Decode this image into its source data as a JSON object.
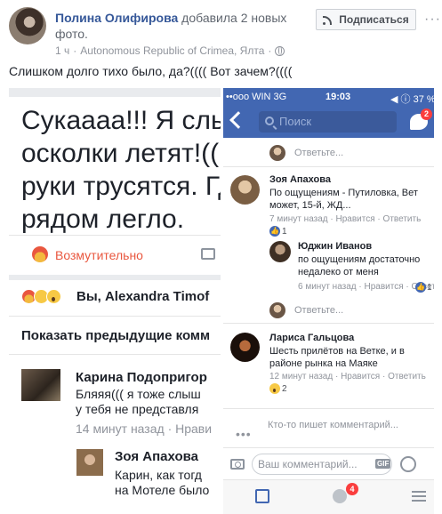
{
  "post": {
    "author": "Полина Олифирова",
    "action": " добавила 2 новых фото.",
    "time": "1 ч",
    "location": "Autonomous Republic of Crimea, Ялта",
    "subscribe_label": "Подписаться",
    "text": "Слишком долго тихо было, да?(((( Вот зачем?(((("
  },
  "left_screenshot": {
    "big_text_lines": [
      "Сукаааа!!! Я слыш",
      "осколки летят!((((",
      "руки трусятся. Гд",
      "рядом легло."
    ],
    "reaction_label": "Возмутительно",
    "reaction_names": "Вы, Alexandra  Timof",
    "prev_comments_label": "Показать предыдущие комм",
    "comment1": {
      "name": "Карина Подопригор",
      "text_lines": [
        "Бляяя((( я тоже слыш",
        "у тебя не представля"
      ],
      "meta": "14 минут назад · Нрави"
    },
    "comment2": {
      "name": "Зоя Апахова",
      "text_lines": [
        "Карин, как тогд",
        "на Мотеле было"
      ]
    }
  },
  "phone": {
    "status_left": "••ooo WIN  3G",
    "status_time": "19:03",
    "status_right": "◀ ⓘ 37 %",
    "search_placeholder": "Поиск",
    "messenger_badge": "2",
    "reply_label": "Ответьте...",
    "comments": [
      {
        "name": "Зоя Апахова",
        "text_lines": [
          "По ощущениям - Путиловка, Вет",
          "может, 15-й, ЖД..."
        ],
        "meta": "7 минут назад · Нравится · Ответить",
        "likes": "1"
      },
      {
        "name": "Юджин Иванов",
        "text_lines": [
          "по ощущениям достаточно",
          "недалеко от меня"
        ],
        "meta": "6 минут назад · Нравится · Ответить",
        "likes": "1"
      },
      {
        "name": "Лариса Гальцова",
        "text_lines": [
          "Шесть прилётов на Ветке, и в",
          "районе рынка на Маяке"
        ],
        "meta": "12 минут назад · Нравится · Ответить",
        "likes": "2"
      }
    ],
    "typing_text": "Кто-то пишет комментарий...",
    "comment_placeholder": "Ваш комментарий...",
    "gif_label": "GIF",
    "tab_badge": "4"
  }
}
